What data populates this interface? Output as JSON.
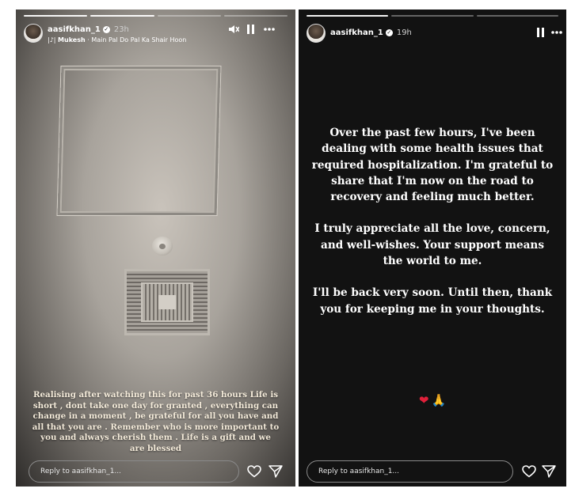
{
  "story1": {
    "progress": [
      "done",
      "done",
      "active",
      "pending"
    ],
    "username": "aasifkhan_1",
    "time": "23h",
    "music": {
      "artist": "Mukesh",
      "separator": " · ",
      "song": "Main Pal Do Pal Ka Shair Hoon"
    },
    "caption": "Realising after watching this for past 36 hours Life is short , dont take one day for granted , everything can change in a moment , be grateful for all you have and all that you are . Remember who is more important to you and always cherish them . Life is a gift and we are blessed",
    "reply_placeholder": "Reply to aasifkhan_1...",
    "icons": [
      "mute-icon",
      "pause-icon",
      "more-icon",
      "heart-icon",
      "send-icon"
    ]
  },
  "story2": {
    "progress": [
      "done",
      "active",
      "pending"
    ],
    "username": "aasifkhan_1",
    "time": "19h",
    "message": {
      "p1": "Over the past few hours, I've been dealing with some health issues that required hospitalization. I'm grateful to share that I'm now on the road to recovery and feeling much better.",
      "p2": "I truly appreciate all the love, concern, and well-wishes. Your support means the world to me.",
      "p3": "I'll be back very soon. Until then, thank you for keeping me in your thoughts."
    },
    "emojis": {
      "heart": "❤",
      "hands": "🙏"
    },
    "reply_placeholder": "Reply to aasifkhan_1...",
    "icons": [
      "pause-icon",
      "more-icon",
      "heart-icon",
      "send-icon"
    ]
  }
}
